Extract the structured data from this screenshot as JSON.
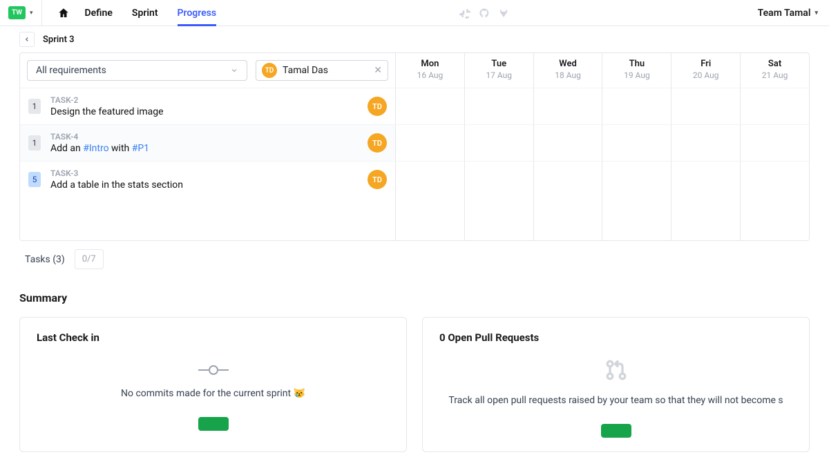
{
  "topbar": {
    "workspace_initials": "TW",
    "nav": {
      "define": "Define",
      "sprint": "Sprint",
      "progress": "Progress"
    },
    "team_label": "Team Tamal"
  },
  "breadcrumb": {
    "sprint": "Sprint 3"
  },
  "filters": {
    "requirements_label": "All requirements",
    "person": {
      "initials": "TD",
      "name": "Tamal Das"
    }
  },
  "days": [
    {
      "name": "Mon",
      "date": "16 Aug"
    },
    {
      "name": "Tue",
      "date": "17 Aug"
    },
    {
      "name": "Wed",
      "date": "18 Aug"
    },
    {
      "name": "Thu",
      "date": "19 Aug"
    },
    {
      "name": "Fri",
      "date": "20 Aug"
    },
    {
      "name": "Sat",
      "date": "21 Aug"
    }
  ],
  "tasks": [
    {
      "points": "1",
      "id": "TASK-2",
      "title_plain": "Design the featured image",
      "assignee": "TD"
    },
    {
      "points": "1",
      "id": "TASK-4",
      "title_pre": "Add an ",
      "tag1": "#Intro",
      "title_mid": " with ",
      "tag2": "#P1",
      "assignee": "TD"
    },
    {
      "points": "5",
      "id": "TASK-3",
      "title_plain": "Add a table in the stats section",
      "assignee": "TD"
    }
  ],
  "footer": {
    "tasks_label": "Tasks (3)",
    "fraction": "0/7"
  },
  "summary": {
    "heading": "Summary",
    "checkin": {
      "title": "Last Check in",
      "message": "No commits made for the current sprint 😿"
    },
    "pr": {
      "title": "0 Open Pull Requests",
      "message": "Track all open pull requests raised by your team so that they will not become s"
    }
  }
}
